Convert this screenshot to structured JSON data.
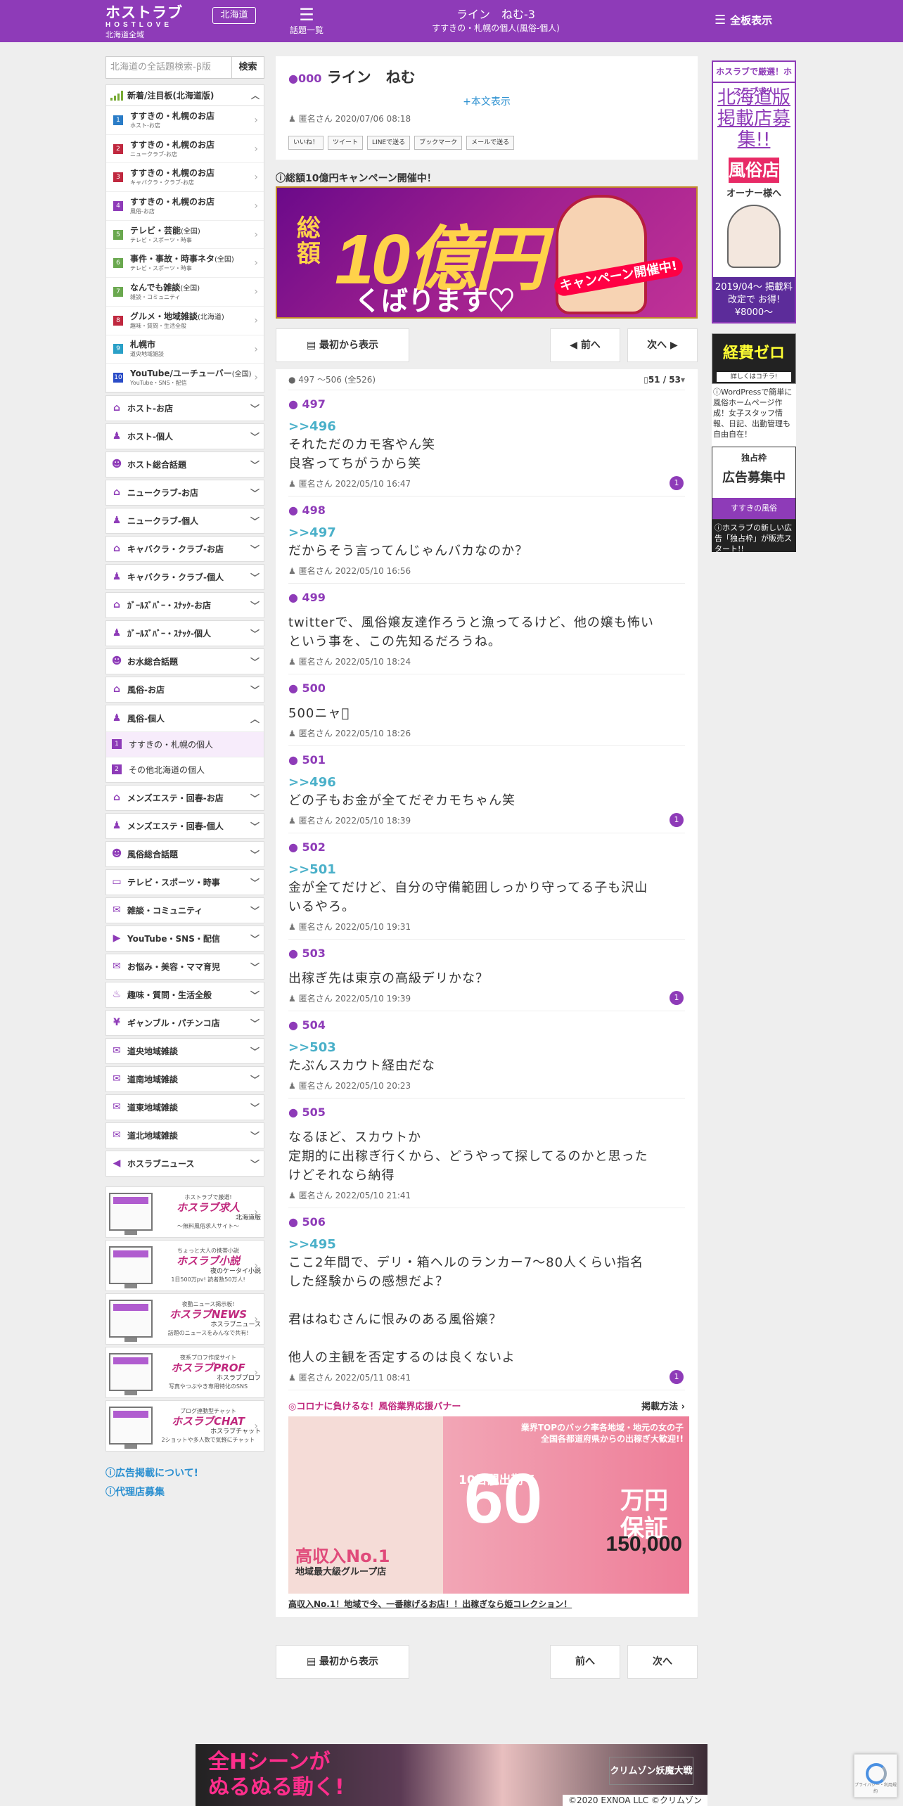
{
  "header": {
    "logo_main": "ホストラブ",
    "logo_sub": "HOSTLOVE",
    "logo_region": "北海道全域",
    "region_button": "北海道",
    "topics_icon": "list-numbered-icon",
    "topics_label": "話題一覧",
    "title": "ライン　ねむ-3",
    "subtitle": "すすきの・札幌の個人(風俗-個人)",
    "all_boards": "全板表示",
    "color": "#8e3bb8"
  },
  "sidebar": {
    "search_placeholder": "北海道の全話題検索-β版",
    "search_button": "検索",
    "news_header": "新着/注目板(北海道版)",
    "items": [
      {
        "num": "1",
        "color": "#2a7cc7",
        "label": "すすきの・札幌のお店",
        "extra": "",
        "sub": "ホスト-お店"
      },
      {
        "num": "2",
        "color": "#c0283f",
        "label": "すすきの・札幌のお店",
        "extra": "",
        "sub": "ニュークラブ-お店"
      },
      {
        "num": "3",
        "color": "#c0283f",
        "label": "すすきの・札幌のお店",
        "extra": "",
        "sub": "キャバクラ・クラブ-お店"
      },
      {
        "num": "4",
        "color": "#8e3bb8",
        "label": "すすきの・札幌のお店",
        "extra": "",
        "sub": "風俗-お店"
      },
      {
        "num": "5",
        "color": "#6aa84f",
        "label": "テレビ・芸能",
        "extra": "(全国)",
        "sub": "テレビ・スポーツ・時事"
      },
      {
        "num": "6",
        "color": "#6aa84f",
        "label": "事件・事故・時事ネタ",
        "extra": "(全国)",
        "sub": "テレビ・スポーツ・時事"
      },
      {
        "num": "7",
        "color": "#6aa84f",
        "label": "なんでも雑談",
        "extra": "(全国)",
        "sub": "雑談・コミュニティ"
      },
      {
        "num": "8",
        "color": "#c0283f",
        "label": "グルメ・地域雑談",
        "extra": "(北海道)",
        "sub": "趣味・質問・生活全般"
      },
      {
        "num": "9",
        "color": "#2aa0c7",
        "label": "札幌市",
        "extra": "",
        "sub": "道央地域雑談"
      },
      {
        "num": "10",
        "color": "#2a4cc7",
        "label": "YouTube/ユーチューバー",
        "extra": "(全国)",
        "sub": "YouTube・SNS・配信"
      }
    ],
    "categories_a": [
      {
        "icon": "house-icon",
        "glyph": "⌂",
        "label": "ホスト-お店"
      },
      {
        "icon": "person-icon",
        "glyph": "♟",
        "label": "ホスト-個人"
      },
      {
        "icon": "group-icon",
        "glyph": "☻",
        "label": "ホスト総合話題"
      },
      {
        "icon": "house-icon",
        "glyph": "⌂",
        "label": "ニュークラブ-お店"
      },
      {
        "icon": "person-icon",
        "glyph": "♟",
        "label": "ニュークラブ-個人"
      },
      {
        "icon": "house-icon",
        "glyph": "⌂",
        "label": "キャバクラ・クラブ-お店"
      },
      {
        "icon": "person-icon",
        "glyph": "♟",
        "label": "キャバクラ・クラブ-個人"
      },
      {
        "icon": "house-icon",
        "glyph": "⌂",
        "label": "ｶﾞｰﾙｽﾞﾊﾞｰ・ｽﾅｯｸ-お店"
      },
      {
        "icon": "person-icon",
        "glyph": "♟",
        "label": "ｶﾞｰﾙｽﾞﾊﾞｰ・ｽﾅｯｸ-個人"
      },
      {
        "icon": "group-icon",
        "glyph": "☻",
        "label": "お水総合話題"
      },
      {
        "icon": "house-icon",
        "glyph": "⌂",
        "label": "風俗-お店"
      }
    ],
    "expanded": {
      "label": "風俗-個人",
      "subs": [
        {
          "num": "1",
          "label": "すすきの・札幌の個人"
        },
        {
          "num": "2",
          "label": "その他北海道の個人"
        }
      ]
    },
    "categories_b": [
      {
        "icon": "house-icon",
        "glyph": "⌂",
        "label": "メンズエステ・回春-お店"
      },
      {
        "icon": "person-icon",
        "glyph": "♟",
        "label": "メンズエステ・回春-個人"
      },
      {
        "icon": "group-icon",
        "glyph": "☻",
        "label": "風俗総合話題"
      },
      {
        "icon": "tv-icon",
        "glyph": "▭",
        "label": "テレビ・スポーツ・時事"
      },
      {
        "icon": "chat-icon",
        "glyph": "✉",
        "label": "雑談・コミュニティ"
      },
      {
        "icon": "youtube-icon",
        "glyph": "▶",
        "label": "YouTube・SNS・配信"
      },
      {
        "icon": "chat-heart-icon",
        "glyph": "✉",
        "label": "お悩み・美容・ママ育児"
      },
      {
        "icon": "fork-knife-icon",
        "glyph": "♨",
        "label": "趣味・質問・生活全般"
      },
      {
        "icon": "money-icon",
        "glyph": "¥",
        "label": "ギャンブル・パチンコ店"
      },
      {
        "icon": "chat-icon",
        "glyph": "✉",
        "label": "道央地域雑談"
      },
      {
        "icon": "chat-icon",
        "glyph": "✉",
        "label": "道南地域雑談"
      },
      {
        "icon": "chat-icon",
        "glyph": "✉",
        "label": "道東地域雑談"
      },
      {
        "icon": "chat-icon",
        "glyph": "✉",
        "label": "道北地域雑談"
      },
      {
        "icon": "speaker-icon",
        "glyph": "◀",
        "label": "ホスラブニュース"
      }
    ],
    "promos": [
      {
        "top": "ホストラブで厳選!",
        "big": "ホスラブ求人",
        "mid": "北海道版",
        "bottom": "〜無料風俗求人サイト〜"
      },
      {
        "top": "ちょっと大人の携帯小説",
        "big": "ホスラブ小説",
        "mid": "夜のケータイ小説",
        "bottom": "1日500万pv! 読者数50万人!"
      },
      {
        "top": "夜動ニュース掲示板!",
        "big": "ホスラブNEWS",
        "mid": "ホスラブニュース",
        "bottom": "話題のニュースをみんなで共有!"
      },
      {
        "top": "夜系プロフ作成サイト",
        "big": "ホスラブPROF",
        "mid": "ホスラブプロフ",
        "bottom": "写真やつぶやき専用特化のSNS"
      },
      {
        "top": "ブログ連動型チャット",
        "big": "ホスラブCHAT",
        "mid": "ホスラブチャット",
        "bottom": "2ショットや多人数で気軽にチャット"
      }
    ],
    "links": [
      "広告掲載について!",
      "代理店募集"
    ]
  },
  "topic": {
    "num": "000",
    "title": "ライン　ねむ",
    "more": "+本文表示",
    "author": "匿名さん 2020/07/06 08:18",
    "share": [
      "いいね！",
      "ツイート",
      "LINEで送る",
      "ブックマーク",
      "メールで送る"
    ],
    "campaign": "総額10億円キャンペーン開催中！",
    "banner": {
      "a": "総額",
      "b": "10億円",
      "c": "くばります♡",
      "d": "キャンペーン開催中!"
    }
  },
  "nav": {
    "first": "最初から表示",
    "prev": "前へ",
    "next": "次へ"
  },
  "thread": {
    "range": "497 〜506",
    "total": "(全526)",
    "page": "51 / 53",
    "posts": [
      {
        "num": "497",
        "anchor": ">>496",
        "body": [
          "それただのカモ客やん笑",
          "良客ってちがうから笑"
        ],
        "meta": "匿名さん 2022/05/10 16:47",
        "badge": "1"
      },
      {
        "num": "498",
        "anchor": ">>497",
        "body": [
          "だからそう言ってんじゃんバカなのか？"
        ],
        "meta": "匿名さん 2022/05/10 16:56",
        "badge": ""
      },
      {
        "num": "499",
        "anchor": "",
        "body": [
          "twitterで、風俗嬢友達作ろうと漁ってるけど、他の嬢も怖い",
          "という事を、この先知るだろうね。"
        ],
        "meta": "匿名さん 2022/05/10 18:24",
        "badge": ""
      },
      {
        "num": "500",
        "anchor": "",
        "body": [
          "500ニャ􀀀"
        ],
        "meta": "匿名さん 2022/05/10 18:26",
        "badge": ""
      },
      {
        "num": "501",
        "anchor": ">>496",
        "body": [
          "どの子もお金が全てだぞカモちゃん笑"
        ],
        "meta": "匿名さん 2022/05/10 18:39",
        "badge": "1"
      },
      {
        "num": "502",
        "anchor": ">>501",
        "body": [
          "金が全てだけど、自分の守備範囲しっかり守ってる子も沢山",
          "いるやろ。"
        ],
        "meta": "匿名さん 2022/05/10 19:31",
        "badge": ""
      },
      {
        "num": "503",
        "anchor": "",
        "body": [
          "出稼ぎ先は東京の高級デリかな？"
        ],
        "meta": "匿名さん 2022/05/10 19:39",
        "badge": "1"
      },
      {
        "num": "504",
        "anchor": ">>503",
        "body": [
          "たぶんスカウト経由だな"
        ],
        "meta": "匿名さん 2022/05/10 20:23",
        "badge": ""
      },
      {
        "num": "505",
        "anchor": "",
        "body": [
          "なるほど、スカウトか",
          "定期的に出稼ぎ行くから、どうやって探してるのかと思った",
          "けどそれなら納得"
        ],
        "meta": "匿名さん 2022/05/10 21:41",
        "badge": ""
      },
      {
        "num": "506",
        "anchor": ">>495",
        "body": [
          "ここ2年間で、デリ・箱ヘルのランカー7〜80人くらい指名",
          "した経験からの感想だよ？",
          "",
          "君はねむさんに恨みのある風俗嬢？",
          "",
          "他人の主観を否定するのは良くないよ"
        ],
        "meta": "匿名さん 2022/05/11 08:41",
        "badge": "1"
      }
    ]
  },
  "ad": {
    "head": "◎コロナに負けるな！風俗業界応援バナー",
    "how": "掲載方法",
    "hd1": "業界TOPのバック率各地域・地元の女の子",
    "hd2": "全国各都道府県からの出稼ぎ大歓迎!!",
    "days": "10日間出勤で",
    "sixty": "60",
    "guarantee": "万円保証",
    "pay": "150,000",
    "no1a": "高収入No.1",
    "no1b": "地域最大級グループ店",
    "link": "高収入No.1！地域で今、一番稼げるお店！！出稼ぎなら姫コレクション！"
  },
  "right": {
    "ad1_top": "ホスラブで厳選！ホスラブ求人",
    "ad1_main": "北海道版掲載店募集!!",
    "ad1_tag": "風俗店",
    "ad1_owner": "オーナー様へ",
    "ad1_bottom": "2019/04〜 掲載料改定で お得!¥8000〜",
    "ad2_main": "経費ゼロ",
    "ad2_text": "WordPressで簡単に風俗ホームページ作成！女子スタッフ情報、日記、出勤管理も自由自在！",
    "ad3_a": "独占枠",
    "ad3_b": "広告募集中",
    "ad3_c": "すすきの風俗",
    "ad3_text": "ホスラブの新しい広告「独占枠」が販売スタート!!"
  },
  "bottom_banner": {
    "text1": "全Hシーンが",
    "text2": "ぬるぬる動く!",
    "logo": "クリムゾン妖魔大戦",
    "copy": "©2020 EXNOA LLC ©クリムゾン"
  },
  "recaptcha": "プライバシー・利用規約"
}
